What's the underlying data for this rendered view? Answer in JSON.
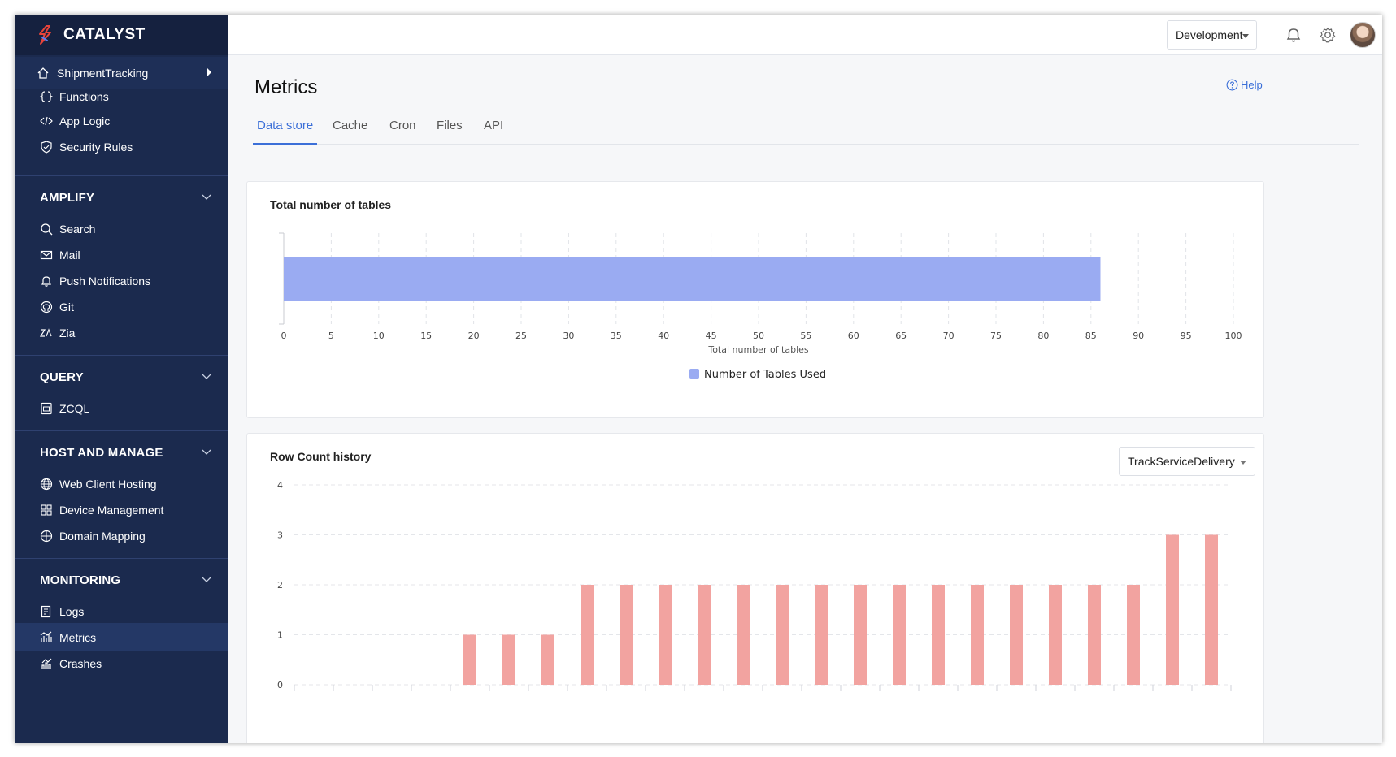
{
  "app": {
    "name": "CATALYST",
    "brand_color": "#e8443a"
  },
  "sidebar": {
    "project": "ShipmentTracking",
    "top_items": [
      {
        "label": "Functions",
        "icon": "braces-icon"
      },
      {
        "label": "App Logic",
        "icon": "code-icon"
      },
      {
        "label": "Security Rules",
        "icon": "shield-icon"
      }
    ],
    "sections": [
      {
        "title": "AMPLIFY",
        "items": [
          {
            "label": "Search",
            "icon": "search-icon"
          },
          {
            "label": "Mail",
            "icon": "mail-icon"
          },
          {
            "label": "Push Notifications",
            "icon": "bell-icon"
          },
          {
            "label": "Git",
            "icon": "git-icon"
          },
          {
            "label": "Zia",
            "icon": "zia-icon"
          }
        ]
      },
      {
        "title": "QUERY",
        "items": [
          {
            "label": "ZCQL",
            "icon": "zcql-icon"
          }
        ]
      },
      {
        "title": "HOST AND MANAGE",
        "items": [
          {
            "label": "Web Client Hosting",
            "icon": "globe-icon"
          },
          {
            "label": "Device Management",
            "icon": "grid-icon"
          },
          {
            "label": "Domain Mapping",
            "icon": "domain-icon"
          }
        ]
      },
      {
        "title": "MONITORING",
        "items": [
          {
            "label": "Logs",
            "icon": "logs-icon"
          },
          {
            "label": "Metrics",
            "icon": "metrics-icon"
          },
          {
            "label": "Crashes",
            "icon": "crashes-icon"
          }
        ]
      }
    ]
  },
  "topbar": {
    "environment": "Development"
  },
  "page": {
    "title": "Metrics",
    "help": "Help",
    "tabs": [
      "Data store",
      "Cache",
      "Cron",
      "Files",
      "API"
    ],
    "active_tab": "Data store"
  },
  "chart_data": [
    {
      "type": "bar",
      "orientation": "horizontal",
      "title": "Total number of tables",
      "categories": [
        ""
      ],
      "series": [
        {
          "name": "Number of Tables Used",
          "values": [
            86
          ],
          "color": "#9aabf2"
        }
      ],
      "xlabel": "Total number of tables",
      "xlim": [
        0,
        100
      ],
      "xticks": [
        0,
        5,
        10,
        15,
        20,
        25,
        30,
        35,
        40,
        45,
        50,
        55,
        60,
        65,
        70,
        75,
        80,
        85,
        90,
        95,
        100
      ],
      "grid": true,
      "legend": "bottom"
    },
    {
      "type": "bar",
      "title": "Row Count history",
      "selector": "TrackServiceDelivery",
      "categories": [
        "",
        "",
        "",
        "",
        "",
        "",
        "",
        "",
        "",
        "",
        "",
        "",
        "",
        "",
        "",
        "",
        "",
        "",
        "",
        "",
        "",
        "",
        "",
        ""
      ],
      "values": [
        0,
        0,
        0,
        0,
        1,
        1,
        1,
        2,
        2,
        2,
        2,
        2,
        2,
        2,
        2,
        2,
        2,
        2,
        2,
        2,
        2,
        2,
        3,
        3
      ],
      "color": "#f2a3a0",
      "ylim": [
        0,
        4
      ],
      "yticks": [
        0,
        1,
        2,
        3,
        4
      ],
      "grid": true
    }
  ]
}
